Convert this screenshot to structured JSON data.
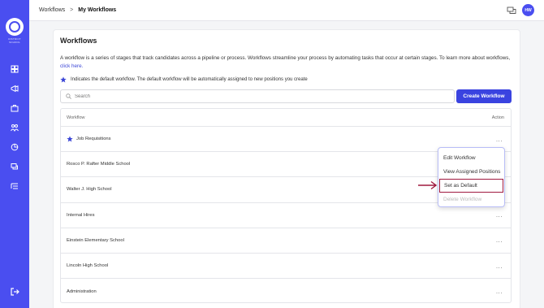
{
  "sidebar": {
    "logo_text": "DISTRICT SCHOOL",
    "icons": [
      "dashboard-icon",
      "megaphone-icon",
      "briefcase-icon",
      "people-icon",
      "chart-icon",
      "chat-icon",
      "list-icon"
    ],
    "logout_icon": "logout-icon"
  },
  "topbar": {
    "breadcrumb_root": "Workflows",
    "breadcrumb_sep": ">",
    "breadcrumb_current": "My Workflows",
    "avatar_initials": "HW"
  },
  "page": {
    "title": "Workflows",
    "description": "A workflow is a series of stages that track candidates across a pipeline or process. Workflows streamline your process by automating tasks that occur at certain stages. To learn more about workflows,",
    "link_text": "click here.",
    "default_note": "Indicates the default workflow. The default workflow will be automatically assigned to new positions you create",
    "search_placeholder": "Search",
    "create_button": "Create Workflow"
  },
  "table": {
    "col_workflow": "Workflow",
    "col_action": "Action",
    "rows": [
      {
        "name": "Job Requisitions",
        "default": true,
        "action": "..."
      },
      {
        "name": "Rosco P. Rafter Middle School",
        "action": "..."
      },
      {
        "name": "Walter J. High School",
        "action": "..."
      },
      {
        "name": "Internal Hires",
        "action": "..."
      },
      {
        "name": "Einstein Elementary School",
        "action": "..."
      },
      {
        "name": "Lincoln High School",
        "action": "..."
      },
      {
        "name": "Administration",
        "action": "..."
      }
    ]
  },
  "menu": {
    "items": [
      "Edit Workflow",
      "View Assigned Positions",
      "Set as Default",
      "Delete Workflow"
    ]
  },
  "colors": {
    "sidebar": "#4a4ef0",
    "primary": "#3a43e0",
    "highlight": "#a0193f"
  }
}
